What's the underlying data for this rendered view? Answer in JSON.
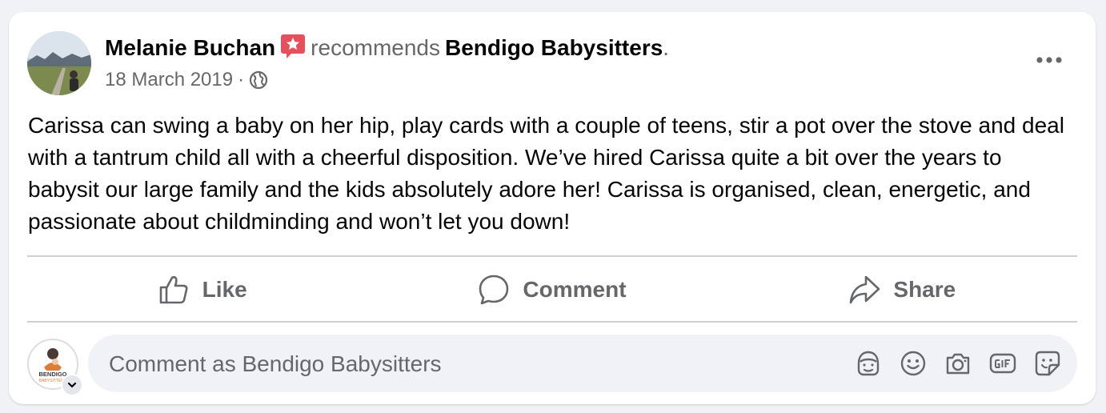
{
  "post": {
    "author": "Melanie Buchan",
    "action": "recommends",
    "page": "Bendigo Babysitters",
    "period": ".",
    "date": "18 March 2019",
    "separator": "·",
    "body": "Carissa can swing a baby on her hip, play cards with a couple of teens, stir a pot over the stove and deal with a tantrum child all with a cheerful disposition. We’ve hired Carissa quite a bit over the years to babysit our large family and the kids absolutely adore her! Carissa is organised, clean, energetic, and passionate about childminding and won’t let you down!"
  },
  "actions": {
    "like": "Like",
    "comment": "Comment",
    "share": "Share"
  },
  "composer": {
    "placeholder": "Comment as Bendigo Babysitters",
    "avatar_text_top": "BENDIGO",
    "avatar_text_bottom": "BABYSITTERS"
  },
  "icons": {
    "recommend": "recommend-star-icon",
    "audience": "globe-icon",
    "more": "more-horizontal-icon",
    "like": "thumbs-up-icon",
    "comment": "speech-bubble-icon",
    "share": "share-arrow-icon",
    "avatar_sticker": "avatar-sticker-icon",
    "emoji": "emoji-icon",
    "camera": "camera-icon",
    "gif": "gif-icon",
    "sticker": "sticker-icon"
  },
  "colors": {
    "recommend_badge": "#e4505b",
    "secondary_text": "#65676b",
    "divider": "#ced0d4"
  }
}
